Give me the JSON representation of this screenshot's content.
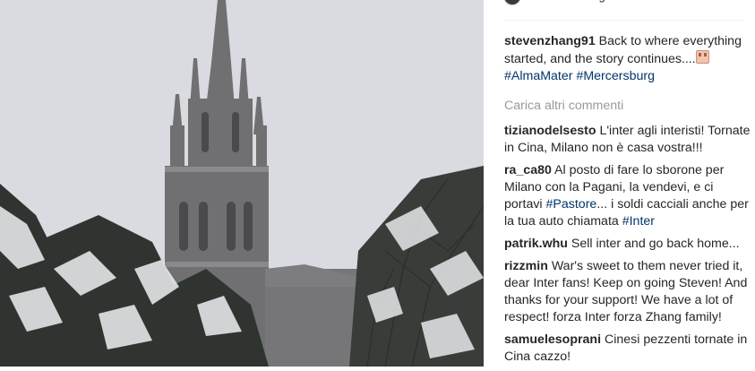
{
  "header": {
    "username": "stevenzhang91",
    "location": "Mercersburg Academy"
  },
  "caption": {
    "username": "stevenzhang91",
    "text_before": " Back to where everything started, and the story continues....",
    "emoji_icon": "family-emoji-icon",
    "hashtag1": "#AlmaMater",
    "hashtag2": "#Mercersburg"
  },
  "load_more": "Carica altri commenti",
  "comments": [
    {
      "username": "tizianodelsesto",
      "text": " L'inter agli interisti! Tornate in Cina, Milano non è casa vostra!!!"
    },
    {
      "username": "ra_ca80",
      "text_before": " Al posto di fare lo sborone per Milano con la Pagani, la vendevi, e ci portavi ",
      "hashtag1": "#Pastore",
      "text_middle": "... i soldi cacciali anche per la tua auto chiamata ",
      "hashtag2": "#Inter"
    },
    {
      "username": "patrik.whu",
      "text": " Sell inter and go back home..."
    },
    {
      "username": "rizzmin",
      "text": " War's sweet to them never tried it, dear Inter fans! Keep on going Steven! And thanks for your support! We have a lot of respect! forza Inter forza Zhang family!"
    },
    {
      "username": "samuelesoprani",
      "text": " Cinesi pezzenti tornate in Cina cazzo!"
    }
  ],
  "colors": {
    "text": "#262626",
    "hashtag": "#003569",
    "muted": "#999999",
    "sky": "#d8d9dd",
    "tower": "#6f6f71"
  }
}
